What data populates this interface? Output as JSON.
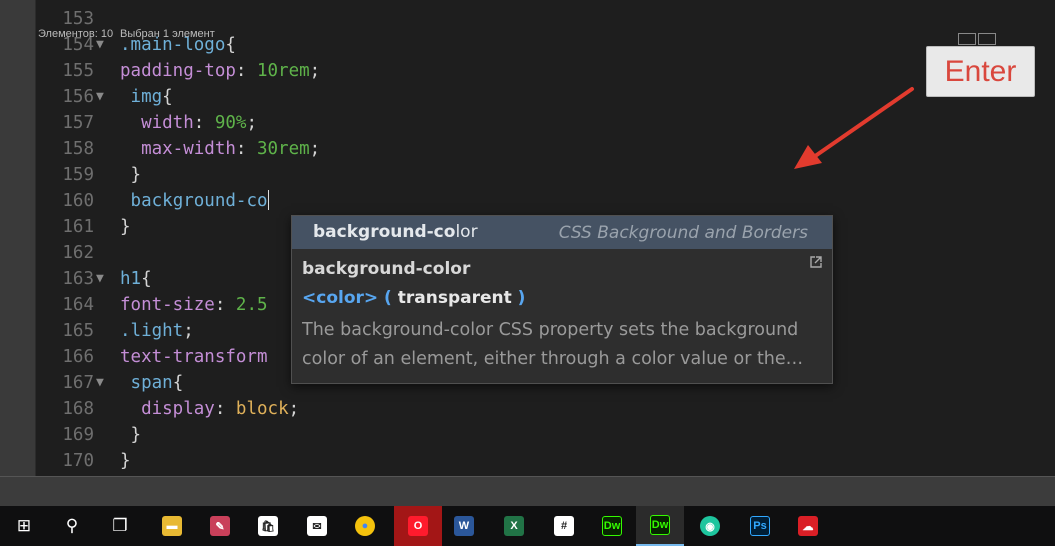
{
  "editor": {
    "lines": [
      {
        "num": "153",
        "fold": "",
        "indent": "",
        "tokens": []
      },
      {
        "num": "154",
        "fold": "▼",
        "indent": "",
        "tokens": [
          {
            "t": ".main-logo",
            "c": "sel"
          },
          {
            "t": "{",
            "c": "punc"
          }
        ]
      },
      {
        "num": "155",
        "fold": "",
        "indent": "",
        "tokens": [
          {
            "t": "padding-top",
            "c": "prop"
          },
          {
            "t": ": ",
            "c": "punc"
          },
          {
            "t": "10rem",
            "c": "num"
          },
          {
            "t": ";",
            "c": "punc"
          }
        ]
      },
      {
        "num": "156",
        "fold": "▼",
        "indent": " ",
        "tokens": [
          {
            "t": "img",
            "c": "sel"
          },
          {
            "t": "{",
            "c": "punc"
          }
        ]
      },
      {
        "num": "157",
        "fold": "",
        "indent": "  ",
        "tokens": [
          {
            "t": "width",
            "c": "prop"
          },
          {
            "t": ": ",
            "c": "punc"
          },
          {
            "t": "90%",
            "c": "num"
          },
          {
            "t": ";",
            "c": "punc"
          }
        ]
      },
      {
        "num": "158",
        "fold": "",
        "indent": "  ",
        "tokens": [
          {
            "t": "max-width",
            "c": "prop"
          },
          {
            "t": ": ",
            "c": "punc"
          },
          {
            "t": "30rem",
            "c": "num"
          },
          {
            "t": ";",
            "c": "punc"
          }
        ]
      },
      {
        "num": "159",
        "fold": "",
        "indent": " ",
        "tokens": [
          {
            "t": "}",
            "c": "punc"
          }
        ]
      },
      {
        "num": "160",
        "fold": "",
        "indent": " ",
        "tokens": [
          {
            "t": "background-co",
            "c": "sel"
          }
        ],
        "caret": true
      },
      {
        "num": "161",
        "fold": "",
        "indent": "",
        "tokens": [
          {
            "t": "}",
            "c": "punc"
          }
        ]
      },
      {
        "num": "162",
        "fold": "",
        "indent": "",
        "tokens": []
      },
      {
        "num": "163",
        "fold": "▼",
        "indent": "",
        "tokens": [
          {
            "t": "h1",
            "c": "sel"
          },
          {
            "t": "{",
            "c": "punc"
          }
        ]
      },
      {
        "num": "164",
        "fold": "",
        "indent": "",
        "tokens": [
          {
            "t": "font-size",
            "c": "prop"
          },
          {
            "t": ": ",
            "c": "punc"
          },
          {
            "t": "2.5",
            "c": "num"
          }
        ]
      },
      {
        "num": "165",
        "fold": "",
        "indent": "",
        "tokens": [
          {
            "t": ".light",
            "c": "sel"
          },
          {
            "t": ";",
            "c": "punc"
          }
        ]
      },
      {
        "num": "166",
        "fold": "",
        "indent": "",
        "tokens": [
          {
            "t": "text-transform",
            "c": "prop"
          }
        ]
      },
      {
        "num": "167",
        "fold": "▼",
        "indent": " ",
        "tokens": [
          {
            "t": "span",
            "c": "sel"
          },
          {
            "t": "{",
            "c": "punc"
          }
        ]
      },
      {
        "num": "168",
        "fold": "",
        "indent": "  ",
        "tokens": [
          {
            "t": "display",
            "c": "prop"
          },
          {
            "t": ": ",
            "c": "punc"
          },
          {
            "t": "block",
            "c": "val"
          },
          {
            "t": ";",
            "c": "punc"
          }
        ]
      },
      {
        "num": "169",
        "fold": "",
        "indent": " ",
        "tokens": [
          {
            "t": "}",
            "c": "punc"
          }
        ]
      },
      {
        "num": "170",
        "fold": "",
        "indent": "",
        "tokens": [
          {
            "t": "}",
            "c": "punc"
          }
        ]
      }
    ]
  },
  "hint": {
    "item_typed": "background-co",
    "item_rest": "lor",
    "item_category": "CSS Background and Borders",
    "title": "background-color",
    "syntax_type": "<color>",
    "syntax_open": " ( ",
    "syntax_value": "transparent",
    "syntax_close": " )",
    "desc_line1": "The background-color CSS property sets the background",
    "desc_line2": "color of an element, either through a color value or the…"
  },
  "callout": {
    "label": "Enter"
  },
  "status": {
    "left": "Элементов: 10",
    "right": "Выбран 1 элемент"
  },
  "taskbar": {
    "items": [
      {
        "name": "start-button",
        "label": "⊞",
        "bg": "",
        "active": false
      },
      {
        "name": "search-button",
        "label": "⚲",
        "bg": "",
        "active": false
      },
      {
        "name": "task-view-button",
        "label": "❐",
        "bg": "",
        "active": false
      },
      {
        "name": "file-explorer-icon",
        "label": "▬",
        "bg": "#e8b933",
        "active": false
      },
      {
        "name": "paint-icon",
        "label": "✎",
        "bg": "#c9405a",
        "active": false
      },
      {
        "name": "store-icon",
        "label": "🛍",
        "bg": "#ffffff",
        "active": false
      },
      {
        "name": "mail-icon",
        "label": "✉",
        "bg": "#ffffff",
        "active": false
      },
      {
        "name": "chrome-icon",
        "label": "●",
        "bg": "#db4437",
        "active": false
      },
      {
        "name": "opera-icon",
        "label": "O",
        "bg": "#ff1b2d",
        "active": false
      },
      {
        "name": "word-icon",
        "label": "W",
        "bg": "#2b579a",
        "active": false
      },
      {
        "name": "excel-icon",
        "label": "X",
        "bg": "#217346",
        "active": false
      },
      {
        "name": "slack-icon",
        "label": "#",
        "bg": "#ffffff",
        "active": false
      },
      {
        "name": "dreamweaver-icon",
        "label": "Dw",
        "bg": "#35fa00",
        "active": false
      },
      {
        "name": "dreamweaver-active-icon",
        "label": "Dw",
        "bg": "#35fa00",
        "active": true
      },
      {
        "name": "drop-icon",
        "label": "◉",
        "bg": "#1ec59e",
        "active": false
      },
      {
        "name": "photoshop-icon",
        "label": "Ps",
        "bg": "#001e36",
        "active": false
      },
      {
        "name": "creative-cloud-icon",
        "label": "☁",
        "bg": "#da1f26",
        "active": false
      }
    ]
  },
  "colors": {
    "editor_bg": "#1e1e1e",
    "hint_highlight": "#455263",
    "callout_text": "#d9473d",
    "arrow": "#e23b2e"
  }
}
